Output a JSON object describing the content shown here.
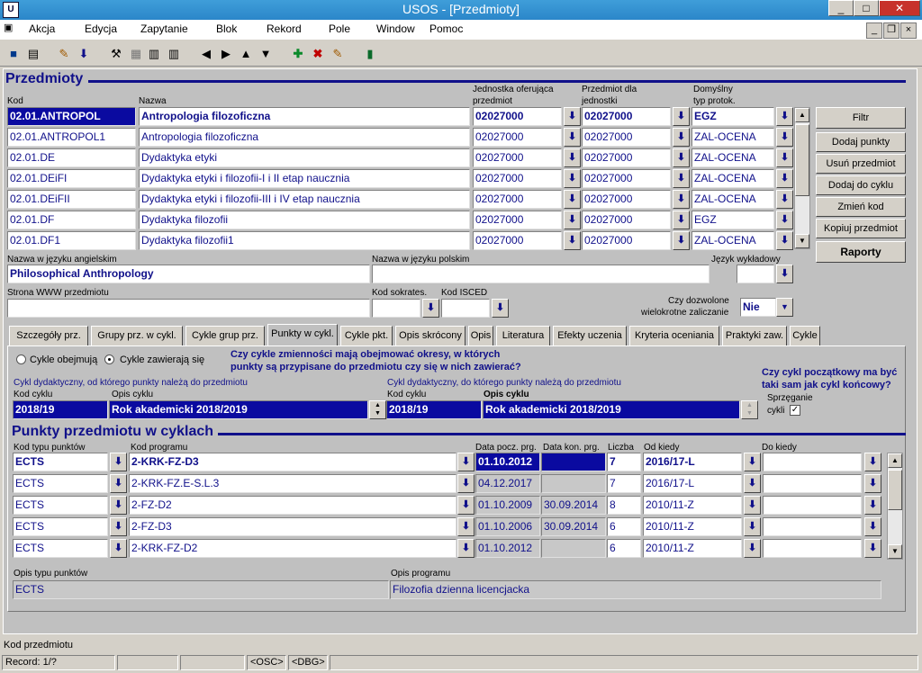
{
  "window": {
    "title": "USOS - [Przedmioty]",
    "app_icon": "app-icon"
  },
  "menu": [
    "Akcja",
    "Edycja",
    "Zapytanie",
    "Blok",
    "Rekord",
    "Pole",
    "Window",
    "Pomoc"
  ],
  "przedmioty": {
    "section_title": "Przedmioty",
    "col_kod": "Kod",
    "col_nazwa": "Nazwa",
    "col_jednostka_1": "Jednostka oferująca",
    "col_jednostka_2": "przedmiot",
    "col_dla_1": "Przedmiot dla",
    "col_dla_2": "jednostki",
    "col_typ_1": "Domyślny",
    "col_typ_2": "typ protok.",
    "rows": [
      {
        "kod": "02.01.ANTROPOL",
        "nazwa": "Antropologia filozoficzna",
        "jedn": "02027000",
        "dla": "02027000",
        "typ": "EGZ"
      },
      {
        "kod": "02.01.ANTROPOL1",
        "nazwa": "Antropologia filozoficzna",
        "jedn": "02027000",
        "dla": "02027000",
        "typ": "ZAL-OCENA"
      },
      {
        "kod": "02.01.DE",
        "nazwa": "Dydaktyka etyki",
        "jedn": "02027000",
        "dla": "02027000",
        "typ": "ZAL-OCENA"
      },
      {
        "kod": "02.01.DEiFI",
        "nazwa": "Dydaktyka etyki i filozofii-I i II etap naucznia",
        "jedn": "02027000",
        "dla": "02027000",
        "typ": "ZAL-OCENA"
      },
      {
        "kod": "02.01.DEiFII",
        "nazwa": "Dydaktyka etyki i filozofii-III i IV etap naucznia",
        "jedn": "02027000",
        "dla": "02027000",
        "typ": "ZAL-OCENA"
      },
      {
        "kod": "02.01.DF",
        "nazwa": "Dydaktyka filozofii",
        "jedn": "02027000",
        "dla": "02027000",
        "typ": "EGZ"
      },
      {
        "kod": "02.01.DF1",
        "nazwa": "Dydaktyka filozofii1",
        "jedn": "02027000",
        "dla": "02027000",
        "typ": "ZAL-OCENA"
      }
    ],
    "buttons": [
      "Filtr",
      "Dodaj punkty",
      "Usuń przedmiot",
      "Dodaj do cyklu",
      "Zmień kod",
      "Kopiuj przedmiot",
      "Raporty"
    ],
    "label_en": "Nazwa w języku angielskim",
    "value_en": "Philosophical Anthropology",
    "label_pl": "Nazwa w języku polskim",
    "value_pl": "",
    "label_jezyk": "Język wykładowy",
    "value_jezyk": "",
    "label_www": "Strona WWW  przedmiotu",
    "value_www": "",
    "label_sokrates": "Kod sokrates.",
    "value_sokrates": "",
    "label_isced": "Kod ISCED",
    "value_isced": "",
    "label_wielo_1": "Czy dozwolone",
    "label_wielo_2": "wielokrotne zaliczanie",
    "value_wielo": "Nie"
  },
  "tabs": [
    "Szczegóły prz.",
    "Grupy prz. w cykl.",
    "Cykle grup prz.",
    "Punkty w cykl.",
    "Cykle pkt.",
    "Opis skrócony",
    "Opis",
    "Literatura",
    "Efekty uczenia",
    "Kryteria oceniania",
    "Praktyki zaw.",
    "Cykle"
  ],
  "active_tab": "Punkty w cykl.",
  "punkty": {
    "radio_1": "Cykle obejmują",
    "radio_2": "Cykle zawierają się",
    "question_1": "Czy cykle zmienności mają obejmować okresy, w których",
    "question_2": "punkty są przypisane do przedmiotu czy się w nich zawierać?",
    "question_r1": "Czy cykl początkowy ma być",
    "question_r2": "taki sam jak cykl końcowy?",
    "cykl_od_label": "Cykl dydaktyczny, od którego punkty należą do przedmiotu",
    "cykl_do_label": "Cykl dydaktyczny, do którego punkty należą do przedmiotu",
    "kod_cyklu": "Kod cyklu",
    "opis_cyklu": "Opis cyklu",
    "od_kod": "2018/19",
    "od_opis": "Rok akademicki 2018/2019",
    "do_kod": "2018/19",
    "do_opis": "Rok akademicki 2018/2019",
    "sprzeganie_1": "Sprzęganie",
    "sprzeganie_2": "cykli",
    "sprzeganie_checked": "✓",
    "section_title": "Punkty przedmiotu w cyklach",
    "h_typ": "Kod typu punktów",
    "h_prog": "Kod programu",
    "h_pocz": "Data pocz. prg.",
    "h_kon": "Data kon. prg.",
    "h_liczba": "Liczba",
    "h_od": "Od kiedy",
    "h_do": "Do kiedy",
    "rows": [
      {
        "typ": "ECTS",
        "prog": "2-KRK-FZ-D3",
        "pocz": "01.10.2012",
        "kon": "",
        "liczba": "7",
        "od": "2016/17-L",
        "do": ""
      },
      {
        "typ": "ECTS",
        "prog": "2-KRK-FZ.E-S.L.3",
        "pocz": "04.12.2017",
        "kon": "",
        "liczba": "7",
        "od": "2016/17-L",
        "do": ""
      },
      {
        "typ": "ECTS",
        "prog": "2-FZ-D2",
        "pocz": "01.10.2009",
        "kon": "30.09.2014",
        "liczba": "8",
        "od": "2010/11-Z",
        "do": ""
      },
      {
        "typ": "ECTS",
        "prog": "2-FZ-D3",
        "pocz": "01.10.2006",
        "kon": "30.09.2014",
        "liczba": "6",
        "od": "2010/11-Z",
        "do": ""
      },
      {
        "typ": "ECTS",
        "prog": "2-KRK-FZ-D2",
        "pocz": "01.10.2012",
        "kon": "",
        "liczba": "6",
        "od": "2010/11-Z",
        "do": ""
      }
    ],
    "opis_typu_label": "Opis typu punktów",
    "opis_typu": "ECTS",
    "opis_prog_label": "Opis programu",
    "opis_prog": "Filozofia dzienna licencjacka"
  },
  "status": {
    "hint": "Kod przedmiotu",
    "record": "Record: 1/?",
    "osc": "<OSC>",
    "dbg": "<DBG>"
  }
}
